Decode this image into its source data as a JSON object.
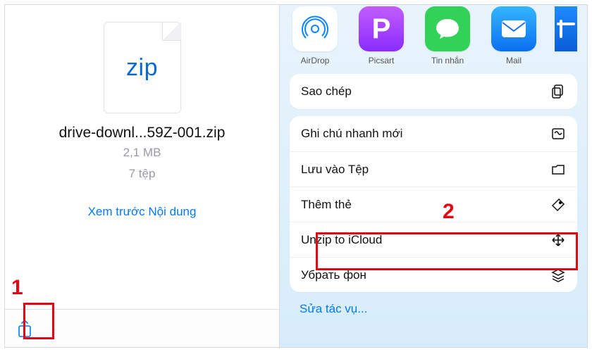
{
  "left": {
    "zip_badge": "zip",
    "filename": "drive-downl...59Z-001.zip",
    "size": "2,1 MB",
    "count": "7 tệp",
    "preview_link": "Xem trước Nội dung"
  },
  "share_apps": [
    {
      "id": "airdrop",
      "label": "AirDrop"
    },
    {
      "id": "picsart",
      "label": "Picsart"
    },
    {
      "id": "messages",
      "label": "Tin nhắn"
    },
    {
      "id": "mail",
      "label": "Mail"
    }
  ],
  "menu_top": {
    "copy": "Sao chép"
  },
  "menu_main": {
    "quick_note": "Ghi chú nhanh mới",
    "save_files": "Lưu vào Tệp",
    "add_tags": "Thêm thẻ",
    "unzip_icloud": "Unzip to iCloud",
    "remove_bg": "Убрать фон"
  },
  "edit_actions": "Sửa tác vụ...",
  "annotations": {
    "one": "1",
    "two": "2"
  }
}
